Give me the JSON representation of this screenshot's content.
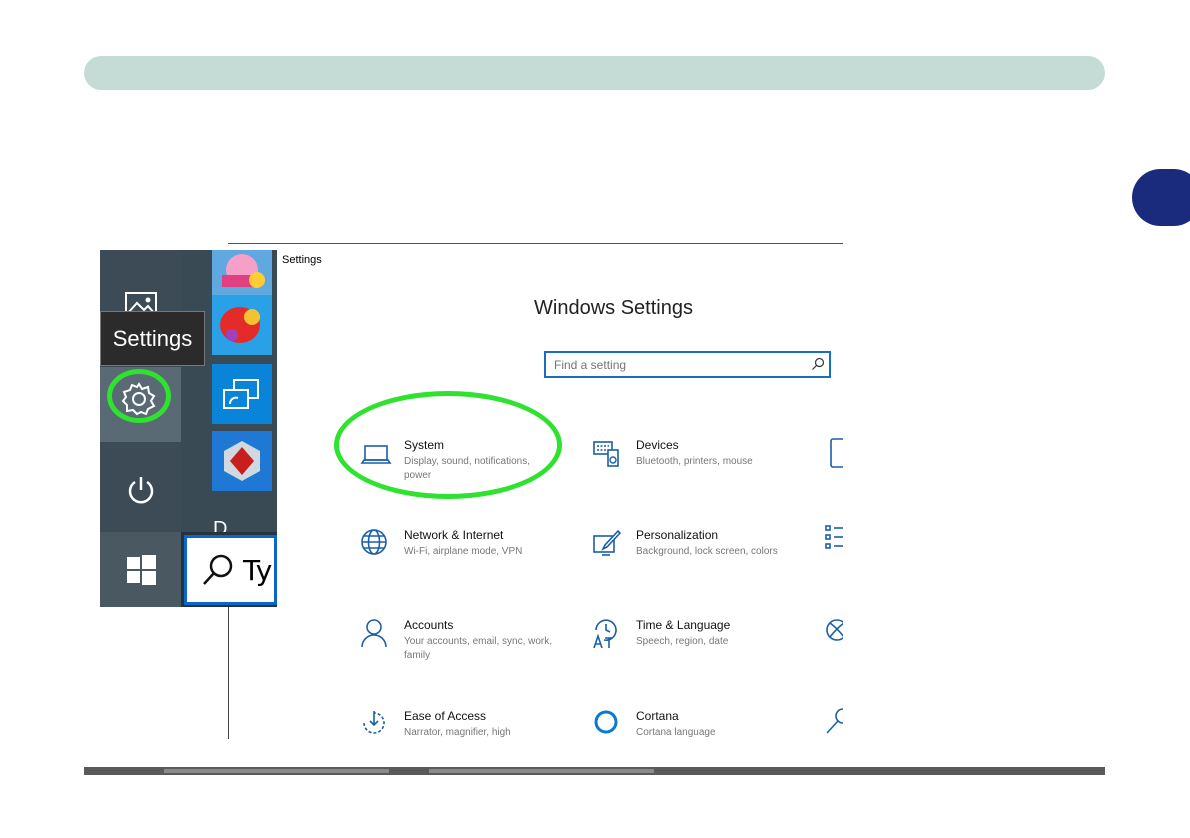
{
  "start_menu": {
    "tooltip": "Settings",
    "partial_letter": "D",
    "search_typed": "Ty",
    "icons": [
      "photos-icon",
      "settings-gear-icon",
      "power-icon",
      "windows-logo-icon",
      "search-icon"
    ],
    "tiles": [
      "friends-game-tile",
      "candy-crush-tile",
      "connect-tile",
      "cube-app-tile"
    ]
  },
  "settings": {
    "window_caption": "Settings",
    "heading": "Windows Settings",
    "search_placeholder": "Find a setting",
    "categories": [
      {
        "title": "System",
        "desc": "Display, sound, notifications, power"
      },
      {
        "title": "Devices",
        "desc": "Bluetooth, printers, mouse"
      },
      {
        "title": "Network & Internet",
        "desc": "Wi-Fi, airplane mode, VPN"
      },
      {
        "title": "Personalization",
        "desc": "Background, lock screen, colors"
      },
      {
        "title": "Accounts",
        "desc": "Your accounts, email, sync, work, family"
      },
      {
        "title": "Time & Language",
        "desc": "Speech, region, date"
      },
      {
        "title": "Ease of Access",
        "desc": "Narrator, magnifier, high"
      },
      {
        "title": "Cortana",
        "desc": "Cortana language"
      }
    ]
  },
  "colors": {
    "highlight": "#2fe22f",
    "accent": "#0078d7",
    "header_bar": "#c5dbd6",
    "chapter_tab": "#1a2a7c"
  }
}
